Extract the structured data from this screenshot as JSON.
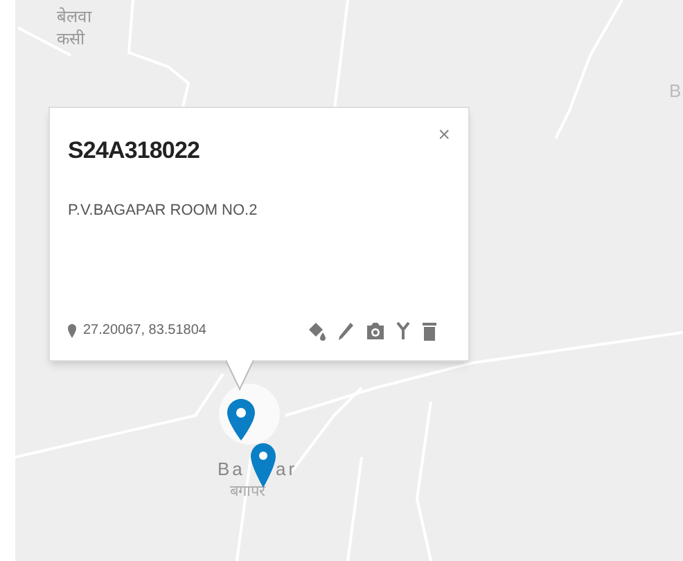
{
  "map": {
    "labels": [
      {
        "text": "बेलवा",
        "kind": "hindi"
      },
      {
        "text": "कसी",
        "kind": "hindi"
      },
      {
        "text": "Ba",
        "kind": "latin"
      },
      {
        "text": "ar",
        "kind": "latin"
      },
      {
        "text": "बगापर",
        "kind": "hindi"
      },
      {
        "text": "B",
        "kind": "latin"
      }
    ]
  },
  "popup": {
    "title": "S24A318022",
    "address": "P.V.BAGAPAR ROOM NO.2",
    "coordinates": "27.20067, 83.51804",
    "close": "×"
  }
}
